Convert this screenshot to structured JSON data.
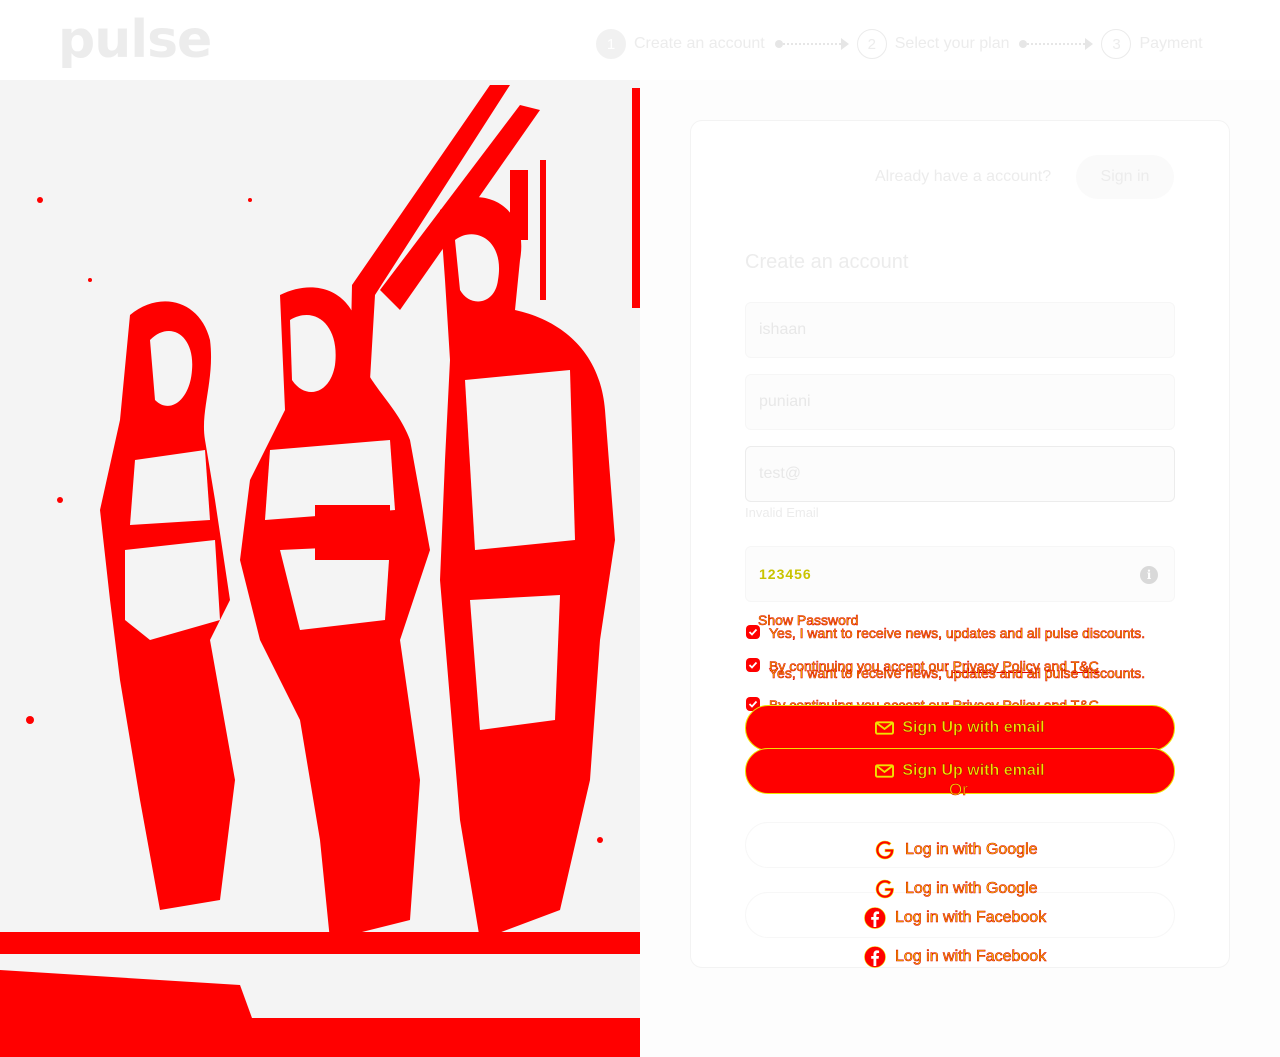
{
  "header": {
    "logo": "pulse",
    "steps": [
      {
        "number": "1",
        "label": "Create an account"
      },
      {
        "number": "2",
        "label": "Select your plan"
      },
      {
        "number": "3",
        "label": "Payment"
      }
    ]
  },
  "hero": {
    "alt_icon": "people-photo"
  },
  "auth": {
    "have_account": "Already have a account?",
    "signin_label": "Sign in"
  },
  "form": {
    "title": "Create an account",
    "first_name": "ishaan",
    "last_name": "puniani",
    "email": "test@",
    "email_error": "Invalid Email",
    "password": "123456",
    "show_password": "Show Password",
    "news_label": "Yes, I want to receive news, updates and all pulse discounts.",
    "terms_prefix": "By continuing you accept our ",
    "privacy_label": "Privacy Policy",
    "terms_and": " and ",
    "tc_label": "T&C",
    "terms_suffix": ".",
    "signup_label": "Sign Up with email",
    "or_label": "Or",
    "google_label": "Log in with Google",
    "facebook_label": "Log in with Facebook"
  },
  "colors": {
    "accent": "#ff0000",
    "overlay_text": "#f0e100"
  }
}
